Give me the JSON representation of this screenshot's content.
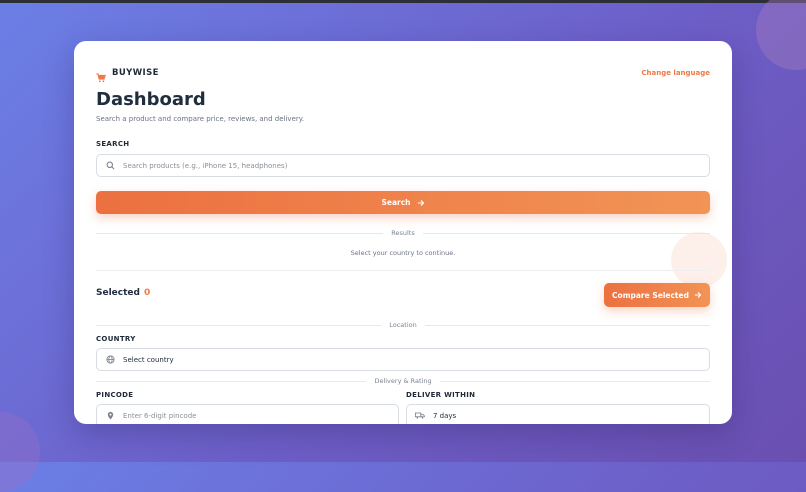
{
  "brand": {
    "name": "BUYWISE",
    "icon": "shopping-cart-icon"
  },
  "header": {
    "change_language": "Change language"
  },
  "page": {
    "title": "Dashboard",
    "subtitle": "Search a product and compare price, reviews, and delivery."
  },
  "search": {
    "label": "SEARCH",
    "placeholder": "Search products (e.g., iPhone 15, headphones)",
    "button_label": "Search"
  },
  "results": {
    "divider": "Results",
    "notice": "Select your country to continue."
  },
  "selection": {
    "label": "Selected",
    "count": "0",
    "compare_label": "Compare Selected"
  },
  "location": {
    "divider": "Location",
    "country_label": "COUNTRY",
    "country_value": "Select country"
  },
  "delivery": {
    "divider": "Delivery & Rating",
    "pincode_label": "PINCODE",
    "pincode_placeholder": "Enter 6-digit pincode",
    "deliver_label": "DELIVER WITHIN",
    "deliver_value": "7 days"
  },
  "colors": {
    "accent": "#ee7a45",
    "bg_start": "#6b7fe6",
    "bg_end": "#6a4fb0"
  }
}
